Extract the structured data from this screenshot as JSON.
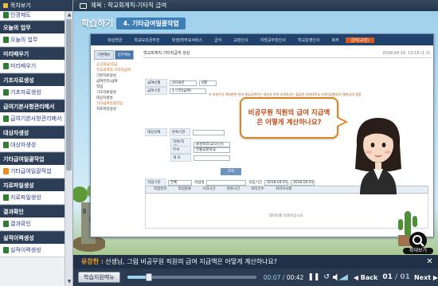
{
  "sidebar": {
    "header": "목차보기",
    "top_partial": "인경제도",
    "items": [
      {
        "type": "section",
        "label": "오늘의 업무"
      },
      {
        "type": "item",
        "label": "오늘의 업무",
        "icon": "green"
      },
      {
        "type": "section",
        "label": "미리배우기"
      },
      {
        "type": "item",
        "label": "미리배우기",
        "icon": "green"
      },
      {
        "type": "section",
        "label": "기초자료생성"
      },
      {
        "type": "item",
        "label": "기초자료생성",
        "icon": "green"
      },
      {
        "type": "section",
        "label": "급여기본사항관리메서"
      },
      {
        "type": "item",
        "label": "급여기본사항관리메서",
        "icon": "green"
      },
      {
        "type": "section",
        "label": "대상자생성"
      },
      {
        "type": "item",
        "label": "대상자생성",
        "icon": "green"
      },
      {
        "type": "section",
        "label": "기타급여일괄작업"
      },
      {
        "type": "item",
        "label": "기타급여일괄작업",
        "icon": "orange"
      },
      {
        "type": "section",
        "label": "지로파일생성"
      },
      {
        "type": "item",
        "label": "지로파일생성",
        "icon": "green"
      },
      {
        "type": "section",
        "label": "결과확인"
      },
      {
        "type": "item",
        "label": "결과확인",
        "icon": "green"
      },
      {
        "type": "section",
        "label": "실적이력생성"
      },
      {
        "type": "item",
        "label": "실적이력생성",
        "icon": "green"
      }
    ]
  },
  "topbar": {
    "label": "제목 : 학교회계직-기타직 급여"
  },
  "stage": {
    "title": "학습하기",
    "subtitle": "4. 기타급여일괄작업",
    "bubble_text": "비공무원 직원의 급여 지급액은 어떻게 계산하나요?"
  },
  "inner_window": {
    "menu": [
      "대상연금",
      "학교보조금추진",
      "학생/학부모서비스",
      "급식",
      "교원인사",
      "지방공무원인사",
      "학교운영인사",
      "복무",
      "급여(교원)"
    ],
    "active_menu_index": 8,
    "nav_tabs": [
      "기본메뉴",
      "업무메뉴"
    ],
    "nav_items": [
      "공공업급/임금",
      "학교회계직-기타직급여",
      "기본자료생성",
      "급여관리/급여",
      "작업",
      "기초자료생성",
      "대상자생성",
      "기타급여일괄작업",
      "지로파일생성"
    ],
    "page_title": "학교회계직·기타직급여 생성",
    "datetime": "2018.04.10. 13:18 (1.3)",
    "form": {
      "pay_year_label": "급여년월",
      "pay_year": "2018년",
      "pay_month": "4월",
      "pay_type_label": "급여구분",
      "pay_type": "1 (기타급여)",
      "target_label": "대상선택",
      "org_label": "본복기관",
      "dept_label": "부서",
      "dept_value": "전출교원학교",
      "grade_label": "직위(직급)",
      "grade_value": "물성처리(교1)(선)",
      "step_label": "개 호",
      "query_btn": "조회"
    },
    "note": "※ 조형수당 역대한번 만내 필요금액이는 대상자 하원 조정처리는 불급여 지원대학교 조정자없쌀부지 결여금의 결정",
    "job_type_label": "작업구분",
    "job_type": "전체",
    "job_name_label": "작업명",
    "job_period_label": "작업기간",
    "job_from": "2018.04.01",
    "job_to": "2018.04.01",
    "grid_title": "작업",
    "grid_columns": [
      "작업번호",
      "작업종류",
      "시작시간",
      "완료시간",
      "처리건수",
      "처리이사항"
    ],
    "grid_empty": "데이터를 조회하십시오."
  },
  "zoom": {
    "label": "확대보기"
  },
  "caption": {
    "speaker": "유창한 :",
    "text": "선생님, 그럼 비공무원 직원의 급여 지급액은 어떻게 계산하나요?"
  },
  "controls": {
    "menu_button": "학습지원메뉴",
    "progress": 0.1667,
    "time_current": "00:07",
    "time_separator": " / ",
    "time_total": "00:42",
    "back_label": "◀ Back",
    "page_current": "01",
    "page_separator": " / ",
    "page_total": "01",
    "next_label": "Next ▶"
  }
}
